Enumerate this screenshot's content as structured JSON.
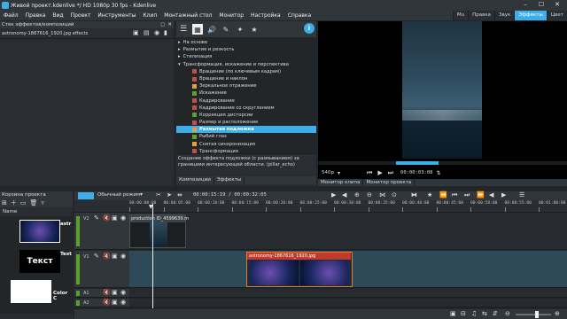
{
  "window": {
    "title": "Живой проект.kdenlive */ HD 1080p 30 fps - Kdenlive",
    "min_glyph": "–",
    "max_glyph": "☐",
    "close_glyph": "✕"
  },
  "menu": [
    "Файл",
    "Правка",
    "Вид",
    "Проект",
    "Инструменты",
    "Клип",
    "Монтажный стол",
    "Монитор",
    "Настройка",
    "Справка"
  ],
  "workspaces": [
    "Мu",
    "Правка",
    "Звук",
    "Эффекты",
    "Цвет"
  ],
  "workspace_active": 3,
  "effect_stack": {
    "title": "Стек эффектов/композиций",
    "clip_label": "astronomy-1867616_1920.jpg effects"
  },
  "effects_list": {
    "items": [
      {
        "label": "На основе",
        "type": "group",
        "color": ""
      },
      {
        "label": "Размытие и резкость",
        "type": "group",
        "color": ""
      },
      {
        "label": "Стилизация",
        "type": "group",
        "color": ""
      },
      {
        "label": "Трансформация, искажение и перспектива",
        "type": "group-open",
        "color": ""
      },
      {
        "label": "Вращение (по ключевым кадрам)",
        "type": "item",
        "color": "#c0504d"
      },
      {
        "label": "Вращение и наклон",
        "type": "item",
        "color": "#c0504d"
      },
      {
        "label": "Зеркальное отражение",
        "type": "item",
        "color": "#e5a03c"
      },
      {
        "label": "Искажение",
        "type": "item",
        "color": "#5aa02c"
      },
      {
        "label": "Кадрирование",
        "type": "item",
        "color": "#c0504d"
      },
      {
        "label": "Кадрирование со скруглением",
        "type": "item",
        "color": "#c0504d"
      },
      {
        "label": "Коррекция дисторсии",
        "type": "item",
        "color": "#5aa02c"
      },
      {
        "label": "Размер и расположение",
        "type": "item",
        "color": "#c0504d"
      },
      {
        "label": "Размытая подложка",
        "type": "item",
        "color": "#e5a03c",
        "selected": true
      },
      {
        "label": "Рыбий глаз",
        "type": "item",
        "color": "#5aa02c"
      },
      {
        "label": "Снятая синхронизация",
        "type": "item",
        "color": "#e5a03c"
      },
      {
        "label": "Трансформация",
        "type": "item",
        "color": "#c0504d"
      }
    ],
    "description": "Создание эффекта подложки (с размыванием) за границами интересующей области. (pillar_echo)",
    "tabs": [
      "Композиции",
      "Эффекты"
    ]
  },
  "monitor": {
    "zoom": "540p",
    "timecode": "00:00:03:08",
    "tabs": [
      "Монитор клипа",
      "Монитор проекта"
    ]
  },
  "bin": {
    "title": "Корзина проекта",
    "column": "Name",
    "items": [
      {
        "label": "astr",
        "thumb": "star"
      },
      {
        "label": "Text",
        "thumb": "Текст"
      },
      {
        "label": "Color C",
        "thumb": "white"
      }
    ]
  },
  "timeline": {
    "mode": "Обычный режим",
    "position": "00:00:15:19 / 00:00:32:05",
    "ruler": [
      "00:00:00:00",
      "00:00:05:00",
      "00:00:10:00",
      "00:00:15:00",
      "00:00:20:00",
      "00:00:25:00",
      "00:00:30:00",
      "00:00:35:00",
      "00:00:40:00",
      "00:00:45:00",
      "00:00:50:00",
      "00:00:55:00",
      "00:01:00:00"
    ],
    "tracks": [
      {
        "id": "V2"
      },
      {
        "id": "V1"
      },
      {
        "id": "A1"
      },
      {
        "id": "A2"
      }
    ],
    "clips": [
      {
        "label": "production ID_4599639.m",
        "track": "V2"
      },
      {
        "label": "astronomy-1867616_1920.jpg",
        "track": "V1"
      }
    ]
  },
  "colors": {
    "accent": "#3daee9",
    "clip_selected_border": "#e67e22"
  }
}
